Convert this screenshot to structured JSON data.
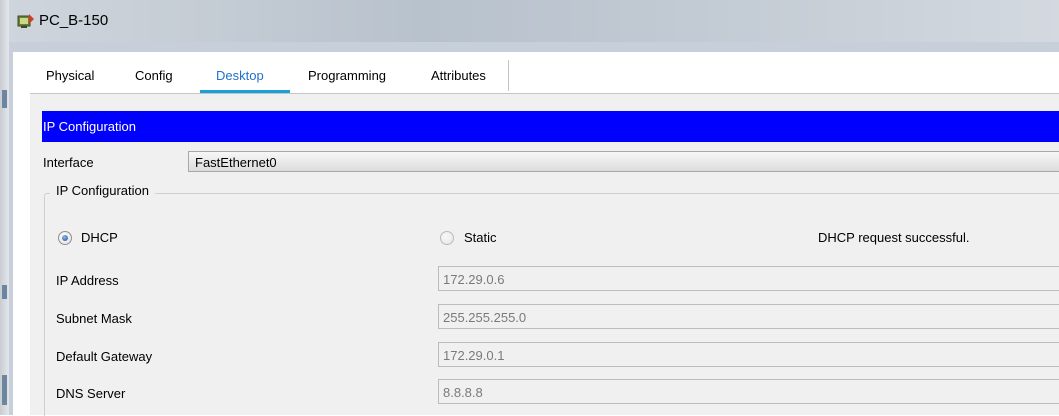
{
  "window": {
    "title": "PC_B-150"
  },
  "tabs": [
    {
      "label": "Physical"
    },
    {
      "label": "Config"
    },
    {
      "label": "Desktop"
    },
    {
      "label": "Programming"
    },
    {
      "label": "Attributes"
    }
  ],
  "active_tab": "Desktop",
  "panel": {
    "header": "IP Configuration",
    "interface_label": "Interface",
    "interface_value": "FastEthernet0",
    "group_title": "IP Configuration",
    "dhcp_label": "DHCP",
    "static_label": "Static",
    "selected_mode": "DHCP",
    "status": "DHCP request successful.",
    "fields": [
      {
        "label": "IP Address",
        "value": "172.29.0.6"
      },
      {
        "label": "Subnet Mask",
        "value": "255.255.255.0"
      },
      {
        "label": "Default Gateway",
        "value": "172.29.0.1"
      },
      {
        "label": "DNS Server",
        "value": "8.8.8.8"
      }
    ]
  },
  "colors": {
    "header_bar": "#0000ff",
    "active_tab_text": "#1f73c8",
    "active_tab_underline": "#18a1d6"
  }
}
